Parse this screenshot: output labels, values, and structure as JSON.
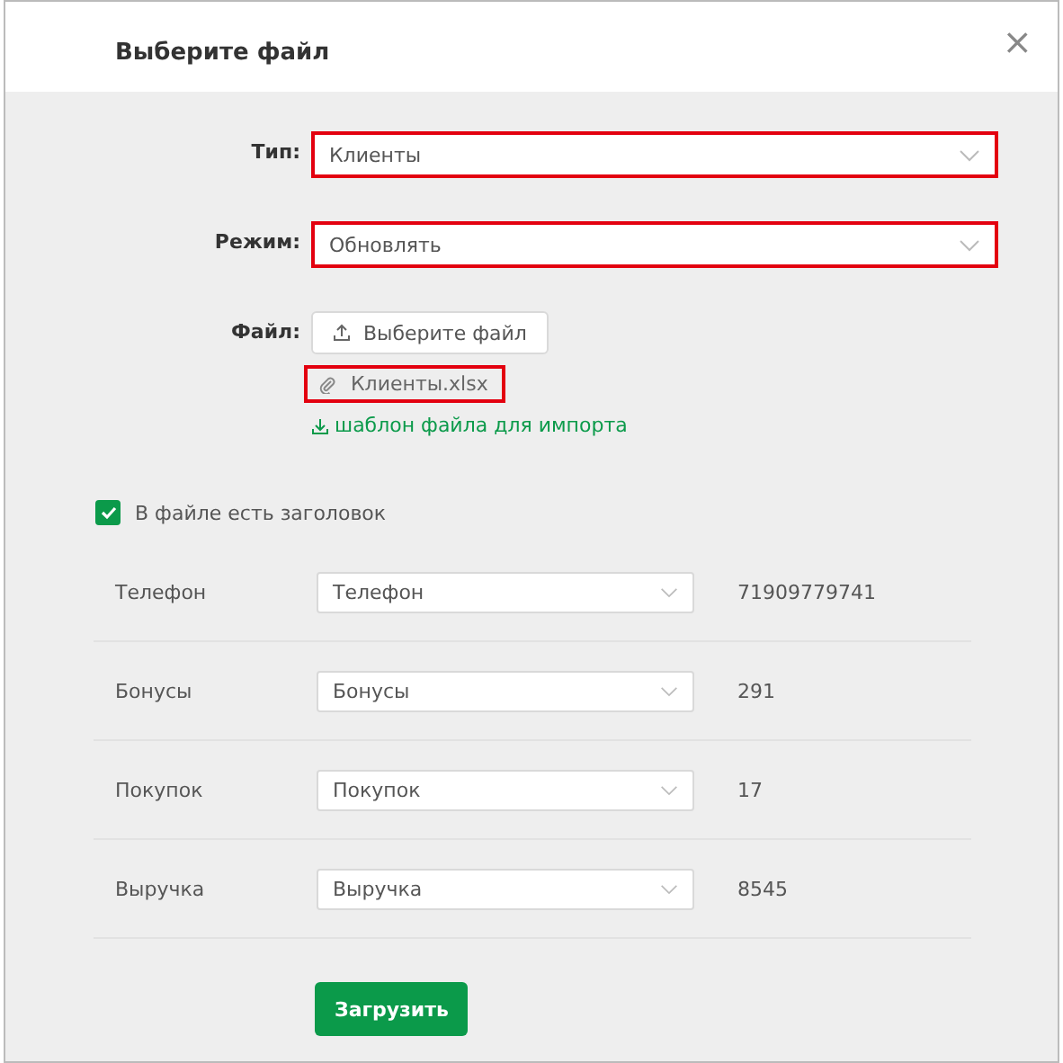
{
  "dialog": {
    "title": "Выберите файл",
    "close": "×"
  },
  "fields": [
    {
      "label": "Тип:",
      "value": "Клиенты",
      "highlighted": true
    },
    {
      "label": "Режим:",
      "value": "Обновлять",
      "highlighted": true
    }
  ],
  "file": {
    "label": "Файл:",
    "button": "Выберите файл",
    "attachment": "Клиенты.xlsx",
    "attachment_highlighted": true,
    "template_link": "шаблон файла для импорта"
  },
  "header_checkbox": {
    "label": "В файле есть заголовок",
    "checked": true
  },
  "mapping": [
    {
      "column": "Телефон",
      "field": "Телефон",
      "sample": "71909779741"
    },
    {
      "column": "Бонусы",
      "field": "Бонусы",
      "sample": "291"
    },
    {
      "column": "Покупок",
      "field": "Покупок",
      "sample": "17"
    },
    {
      "column": "Выручка",
      "field": "Выручка",
      "sample": "8545"
    }
  ],
  "submit": "Загрузить"
}
